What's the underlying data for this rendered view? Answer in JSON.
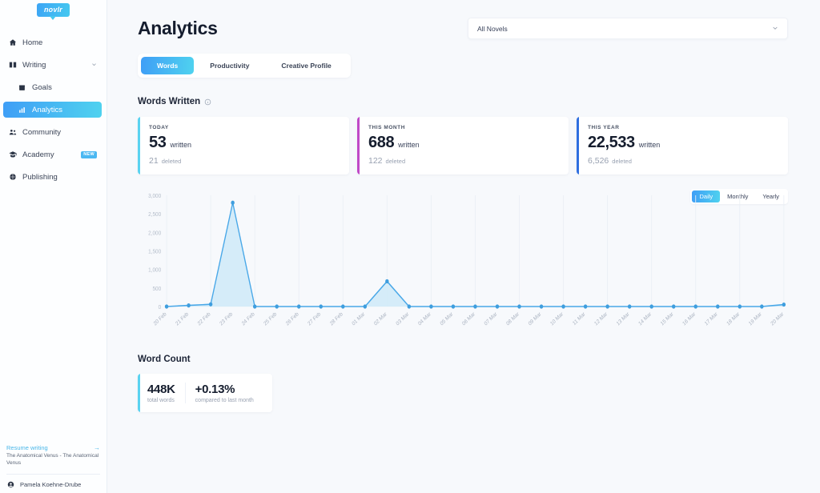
{
  "sidebar": {
    "logo_text": "novlr",
    "items": [
      {
        "label": "Home",
        "icon": "home-icon",
        "active": false,
        "sub": false,
        "chevron": false,
        "badge": ""
      },
      {
        "label": "Writing",
        "icon": "book-icon",
        "active": false,
        "sub": false,
        "chevron": true,
        "badge": ""
      },
      {
        "label": "Goals",
        "icon": "calendar-icon",
        "active": false,
        "sub": true,
        "chevron": false,
        "badge": ""
      },
      {
        "label": "Analytics",
        "icon": "bar-chart-icon",
        "active": true,
        "sub": true,
        "chevron": false,
        "badge": ""
      },
      {
        "label": "Community",
        "icon": "people-icon",
        "active": false,
        "sub": false,
        "chevron": false,
        "badge": ""
      },
      {
        "label": "Academy",
        "icon": "graduation-cap-icon",
        "active": false,
        "sub": false,
        "chevron": false,
        "badge": "NEW"
      },
      {
        "label": "Publishing",
        "icon": "globe-icon",
        "active": false,
        "sub": false,
        "chevron": false,
        "badge": ""
      }
    ],
    "footer": {
      "resume_label": "Resume writing",
      "resume_arrow": "→",
      "resume_subtitle": "The Anatomical Venus - The Anatomical Venus",
      "user_name": "Pamela Koehne-Drube"
    }
  },
  "header": {
    "title": "Analytics",
    "novel_select_value": "All Novels",
    "chevron": "⌄"
  },
  "tabs": [
    {
      "label": "Words",
      "active": true
    },
    {
      "label": "Productivity",
      "active": false
    },
    {
      "label": "Creative Profile",
      "active": false
    }
  ],
  "words_written": {
    "section_title": "Words Written",
    "cards": [
      {
        "label": "TODAY",
        "value": "53",
        "unit": "written",
        "sub_value": "21",
        "sub_label": "deleted",
        "accent": "#5ad3f0"
      },
      {
        "label": "THIS MONTH",
        "value": "688",
        "unit": "written",
        "sub_value": "122",
        "sub_label": "deleted",
        "accent": "#c049c8"
      },
      {
        "label": "THIS YEAR",
        "value": "22,533",
        "unit": "written",
        "sub_value": "6,526",
        "sub_label": "deleted",
        "accent": "#2f6fe0"
      }
    ]
  },
  "range_toggle": [
    {
      "label": "Daily",
      "active": true
    },
    {
      "label": "Monthly",
      "active": false
    },
    {
      "label": "Yearly",
      "active": false
    }
  ],
  "word_count": {
    "section_title": "Word Count",
    "total_value": "448K",
    "total_label": "total words",
    "change_value": "+0.13%",
    "change_label": "compared to last month"
  },
  "chart_data": {
    "type": "area",
    "title": "",
    "xlabel": "",
    "ylabel": "",
    "ylim": [
      0,
      3000
    ],
    "yticks": [
      "0",
      "500",
      "1,000",
      "1,500",
      "2,000",
      "2,500",
      "3,000"
    ],
    "ytick_values": [
      0,
      500,
      1000,
      1500,
      2000,
      2500,
      3000
    ],
    "grid": true,
    "legend": "none",
    "line_color": "#49a8e8",
    "fill_color": "#cfeaf8",
    "point_color": "#3f9ede",
    "categories": [
      "20 Feb",
      "21 Feb",
      "22 Feb",
      "23 Feb",
      "24 Feb",
      "25 Feb",
      "26 Feb",
      "27 Feb",
      "28 Feb",
      "01 Mar",
      "02 Mar",
      "03 Mar",
      "04 Mar",
      "05 Mar",
      "06 Mar",
      "07 Mar",
      "08 Mar",
      "09 Mar",
      "10 Mar",
      "11 Mar",
      "12 Mar",
      "13 Mar",
      "14 Mar",
      "15 Mar",
      "16 Mar",
      "17 Mar",
      "18 Mar",
      "19 Mar",
      "20 Mar"
    ],
    "values": [
      0,
      30,
      60,
      2800,
      0,
      0,
      0,
      0,
      0,
      0,
      680,
      0,
      0,
      0,
      0,
      0,
      0,
      0,
      0,
      0,
      0,
      0,
      0,
      0,
      0,
      0,
      0,
      0,
      53
    ]
  }
}
